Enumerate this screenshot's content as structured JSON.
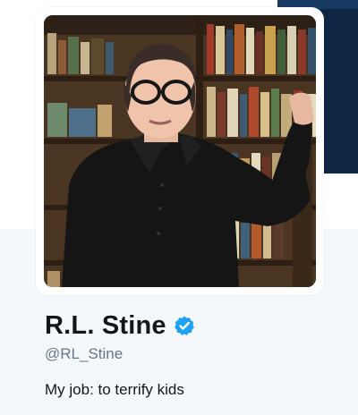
{
  "profile": {
    "display_name": "R.L. Stine",
    "handle": "@RL_Stine",
    "bio": "My job: to terrify kids",
    "verified_icon": "verified-badge-icon",
    "avatar_description_icon": "profile-photo"
  },
  "colors": {
    "name": "#14171a",
    "handle": "#657786",
    "verified": "#1da1f2",
    "profile_bg": "#f5f8fa",
    "banner_dark": "#0f2544"
  }
}
